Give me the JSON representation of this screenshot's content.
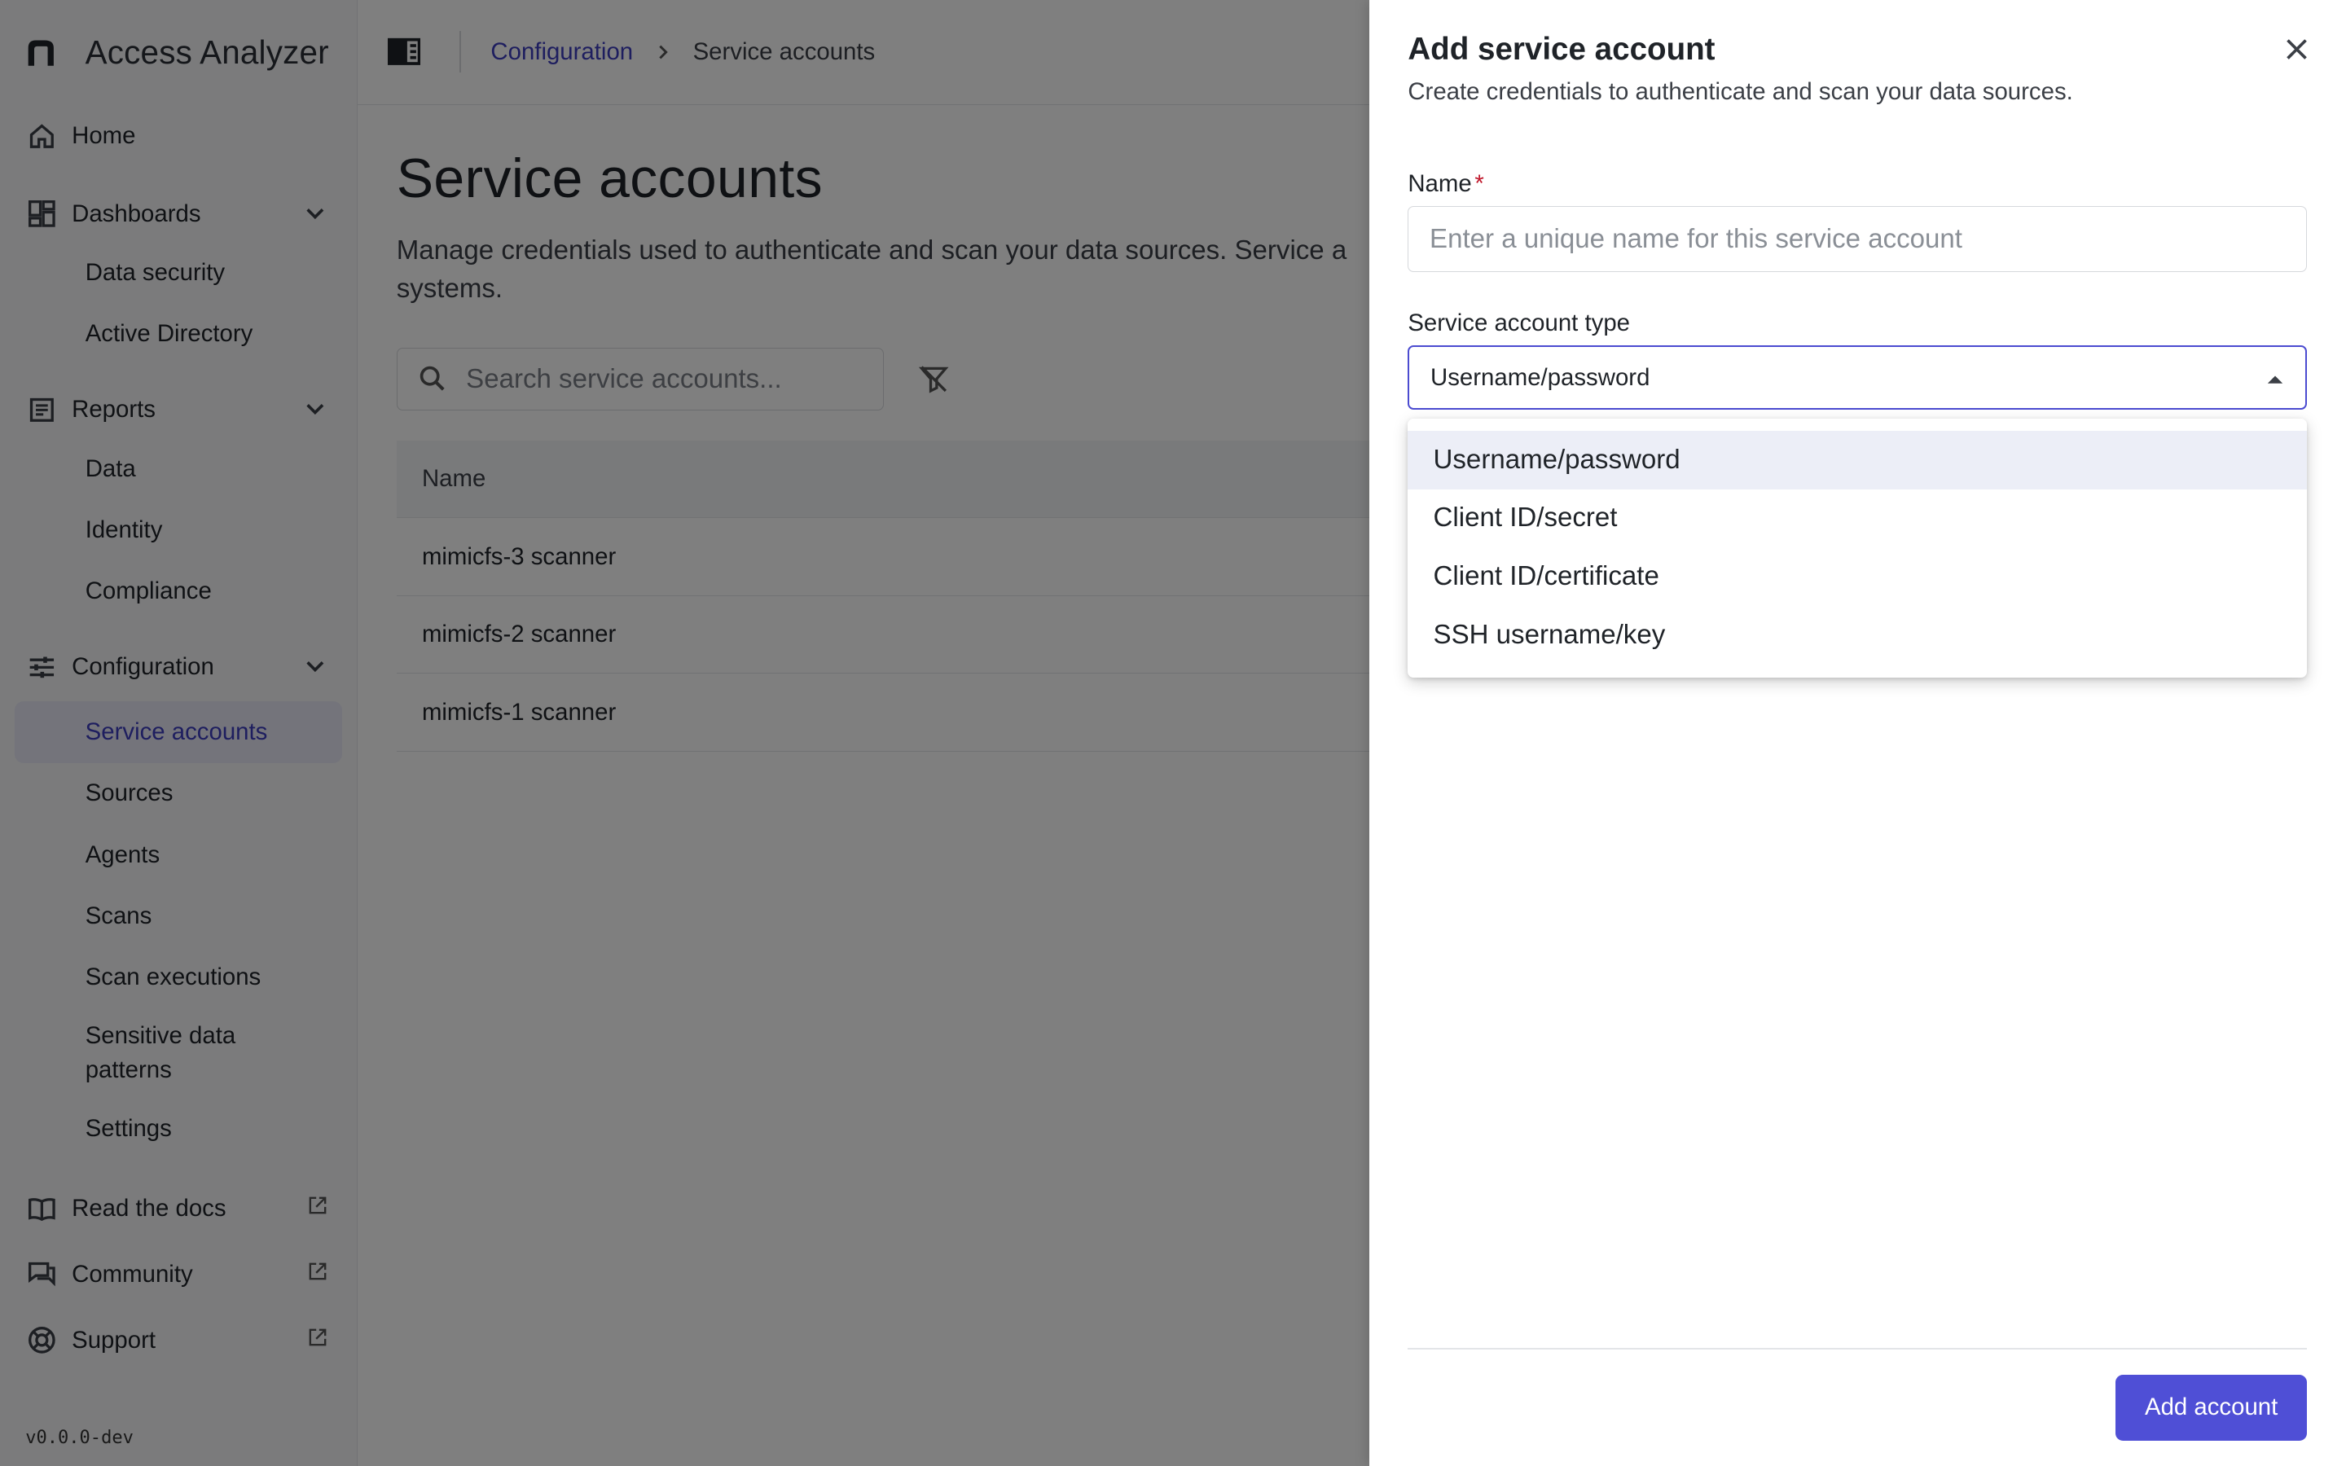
{
  "app": {
    "name": "Access Analyzer",
    "version": "v0.0.0-dev"
  },
  "sidebar": {
    "home": "Home",
    "dashboards": {
      "label": "Dashboards",
      "items": [
        "Data security",
        "Active Directory"
      ]
    },
    "reports": {
      "label": "Reports",
      "items": [
        "Data",
        "Identity",
        "Compliance"
      ]
    },
    "configuration": {
      "label": "Configuration",
      "items": [
        "Service accounts",
        "Sources",
        "Agents",
        "Scans",
        "Scan executions",
        "Sensitive data patterns",
        "Settings"
      ],
      "active": "Service accounts"
    },
    "links": [
      "Read the docs",
      "Community",
      "Support"
    ]
  },
  "breadcrumb": {
    "parent": "Configuration",
    "current": "Service accounts"
  },
  "page": {
    "title": "Service accounts",
    "description": "Manage credentials used to authenticate and scan your data sources. Service a systems."
  },
  "search": {
    "placeholder": "Search service accounts..."
  },
  "table": {
    "columns": [
      "Name"
    ],
    "rows": [
      "mimicfs-3 scanner",
      "mimicfs-2 scanner",
      "mimicfs-1 scanner"
    ]
  },
  "drawer": {
    "title": "Add service account",
    "subtitle": "Create credentials to authenticate and scan your data sources.",
    "name_label": "Name",
    "name_required": "*",
    "name_placeholder": "Enter a unique name for this service account",
    "type_label": "Service account type",
    "type_value": "Username/password",
    "type_options": [
      "Username/password",
      "Client ID/secret",
      "Client ID/certificate",
      "SSH username/key"
    ],
    "submit_label": "Add account"
  },
  "colors": {
    "accent": "#4f4fd6",
    "link": "#3d3dbf",
    "required": "#c0182c"
  }
}
